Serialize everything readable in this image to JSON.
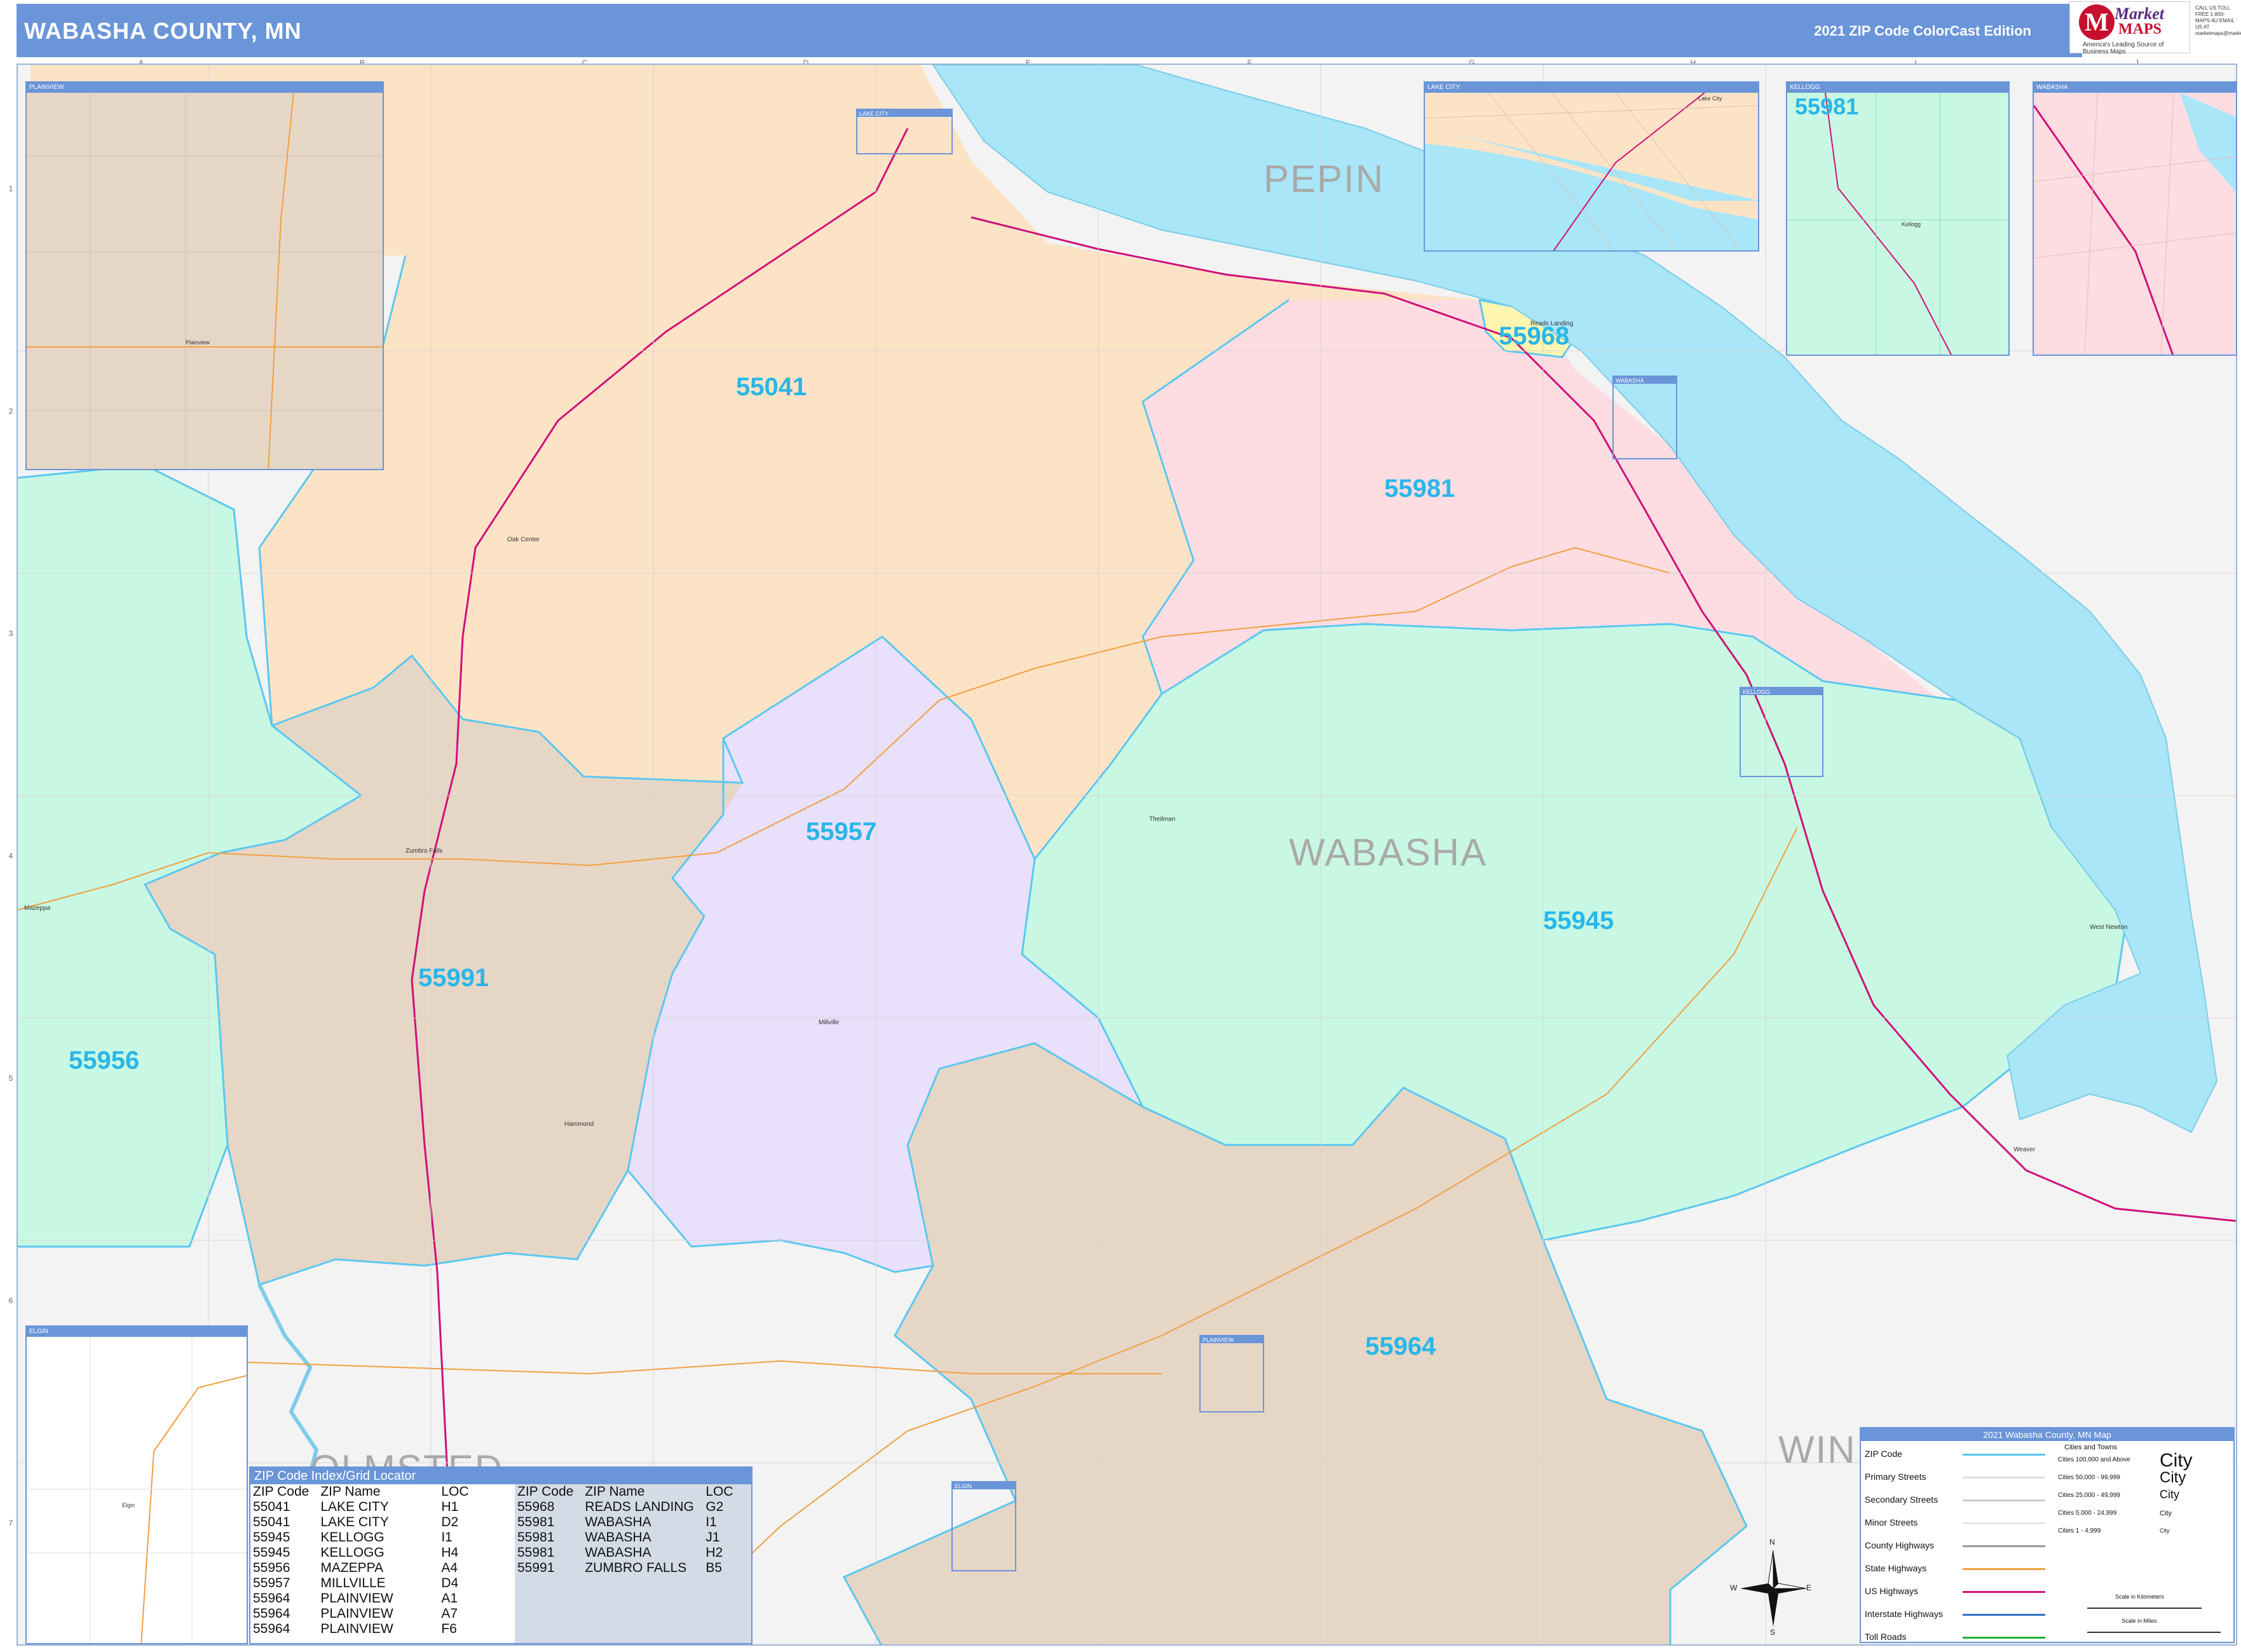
{
  "header": {
    "title": "WABASHA COUNTY, MN",
    "edition": "2021 ZIP Code ColorCast Edition"
  },
  "logo": {
    "brand_top": "Market",
    "brand_bottom": "MAPS",
    "tagline": "America's Leading Source of Business Maps",
    "contact": "CALL US TOLL FREE 1-800-MAPS-4U  EMAIL US AT marketmaps@marketmaps.com"
  },
  "grid": {
    "columns": [
      "A",
      "B",
      "C",
      "D",
      "E",
      "F",
      "G",
      "H",
      "I",
      "J"
    ],
    "rows": [
      "1",
      "2",
      "3",
      "4",
      "5",
      "6",
      "7"
    ]
  },
  "zip_areas": [
    {
      "zip": "55041",
      "color": "#fde3c6"
    },
    {
      "zip": "55981",
      "color": "#fddde2"
    },
    {
      "zip": "55945",
      "color": "#c8f8e3"
    },
    {
      "zip": "55956",
      "color": "#c8f8e3"
    },
    {
      "zip": "55957",
      "color": "#e9e0fb"
    },
    {
      "zip": "55991",
      "color": "#e6d6c6"
    },
    {
      "zip": "55964",
      "color": "#e6d6c6"
    },
    {
      "zip": "55968",
      "color": "#fdf5b0"
    }
  ],
  "zip_labels": [
    "55041",
    "55981",
    "55957",
    "55945",
    "55991",
    "55956",
    "55964",
    "55968",
    "55981"
  ],
  "county_labels": [
    "PEPIN",
    "WABASHA",
    "OLMSTED",
    "WIN"
  ],
  "places": [
    "Oak Center",
    "Zumbro Falls",
    "Mazeppa",
    "Millville",
    "Hammond",
    "Theilman",
    "West Newton",
    "Kellogg",
    "Reads Landing",
    "Weaver",
    "Lake City",
    "Plainview",
    "Elgin"
  ],
  "insets": [
    {
      "title": "PLAINVIEW",
      "place": "Plainview"
    },
    {
      "title": "LAKE CITY",
      "place": "Lake City"
    },
    {
      "title": "KELLOGG",
      "place": "Kellogg"
    },
    {
      "title": "WABASHA",
      "place": ""
    },
    {
      "title": "ELGIN",
      "place": "Elgin"
    }
  ],
  "map_boxes": [
    "LAKE CITY",
    "WABASHA",
    "KELLOGG",
    "PLAINVIEW",
    "ELGIN"
  ],
  "index_table": {
    "title": "ZIP Code Index/Grid Locator",
    "headers": [
      "ZIP Code",
      "ZIP Name",
      "LOC"
    ],
    "left": [
      [
        "55041",
        "LAKE CITY",
        "H1"
      ],
      [
        "55041",
        "LAKE CITY",
        "D2"
      ],
      [
        "55945",
        "KELLOGG",
        "I1"
      ],
      [
        "55945",
        "KELLOGG",
        "H4"
      ],
      [
        "55956",
        "MAZEPPA",
        "A4"
      ],
      [
        "55957",
        "MILLVILLE",
        "D4"
      ],
      [
        "55964",
        "PLAINVIEW",
        "A1"
      ],
      [
        "55964",
        "PLAINVIEW",
        "A7"
      ],
      [
        "55964",
        "PLAINVIEW",
        "F6"
      ]
    ],
    "right": [
      [
        "55968",
        "READS LANDING",
        "G2"
      ],
      [
        "55981",
        "WABASHA",
        "I1"
      ],
      [
        "55981",
        "WABASHA",
        "J1"
      ],
      [
        "55981",
        "WABASHA",
        "H2"
      ],
      [
        "55991",
        "ZUMBRO FALLS",
        "B5"
      ]
    ]
  },
  "legend": {
    "title": "2021 Wabasha County, MN Map",
    "items": [
      {
        "label": "ZIP Code",
        "color": "#5ac8f0"
      },
      {
        "label": "Primary Streets",
        "color": "#dddddd"
      },
      {
        "label": "Secondary Streets",
        "color": "#cccccc"
      },
      {
        "label": "Minor Streets",
        "color": "#e6e6e6"
      },
      {
        "label": "County Highways",
        "color": "#999999"
      },
      {
        "label": "State Highways",
        "color": "#f0a040"
      },
      {
        "label": "US Highways",
        "color": "#d0107a"
      },
      {
        "label": "Interstate Highways",
        "color": "#3070c0"
      },
      {
        "label": "Toll Roads",
        "color": "#20b030"
      }
    ],
    "cities_heading": "Cities and Towns",
    "cities": [
      {
        "range": "Cities 100,000 and Above",
        "sample": "City"
      },
      {
        "range": "Cities 50,000 - 99,999",
        "sample": "City"
      },
      {
        "range": "Cities 25,000 - 49,999",
        "sample": "City"
      },
      {
        "range": "Cities 5,000 - 24,999",
        "sample": "City"
      },
      {
        "range": "Cities 1 - 4,999",
        "sample": "City"
      }
    ],
    "scale_km": "Scale in Kilometers",
    "scale_mi": "Scale in Miles"
  },
  "compass": {
    "n": "N",
    "s": "S",
    "e": "E",
    "w": "W"
  }
}
